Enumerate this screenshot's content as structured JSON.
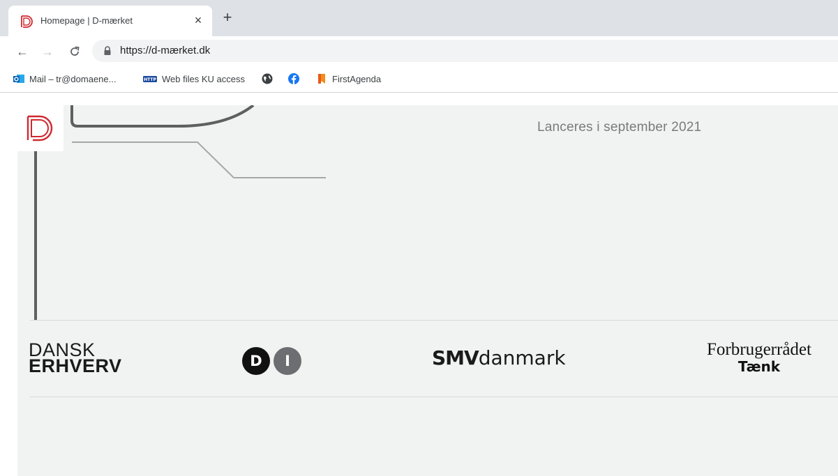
{
  "browser": {
    "tab": {
      "title": "Homepage | D-mærket",
      "close_glyph": "×"
    },
    "new_tab_glyph": "+",
    "nav": {
      "back_glyph": "←",
      "forward_glyph": "→",
      "reload_glyph": "C"
    },
    "url": "https://d-mærket.dk",
    "bookmarks": [
      {
        "label": "Mail – tr@domaene...",
        "icon": "outlook-icon"
      },
      {
        "label": "Web files KU access",
        "icon": "http-icon"
      },
      {
        "label": "",
        "icon": "globe-icon"
      },
      {
        "label": "",
        "icon": "facebook-icon"
      },
      {
        "label": "FirstAgenda",
        "icon": "bookmark-icon"
      }
    ]
  },
  "page": {
    "tagline": "Lanceres i september 2021",
    "partners": {
      "dansk_erhverv": {
        "line1": "DANSK",
        "line2": "ERHVERV"
      },
      "di": {
        "letter1": "D",
        "letter2": "I"
      },
      "smv": {
        "bold": "SMV",
        "regular": "danmark"
      },
      "forbrugerraadet": {
        "line1": "Forbrugerrådet",
        "line2": "Tænk"
      }
    }
  },
  "colors": {
    "brand_red": "#d0282f",
    "page_bg": "#f1f2f2",
    "deco_dark": "#5f5f5f",
    "deco_light": "#a7a7a7",
    "tagline": "#7a7a7a"
  }
}
